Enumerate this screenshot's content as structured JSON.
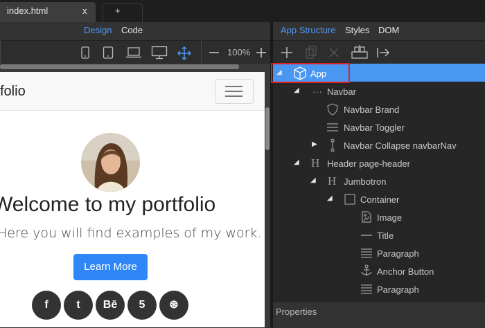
{
  "tabs": {
    "active": "index.html",
    "close": "x",
    "new": "+"
  },
  "left_panel": {
    "modes": {
      "design": "Design",
      "code": "Code"
    },
    "zoom": "100%"
  },
  "preview": {
    "brand": "folio",
    "heading": "Welcome to my portfolio",
    "subtitle": "Here you will find examples of my work.",
    "cta": "Learn More",
    "social": [
      "f",
      "t",
      "Bē",
      "5",
      "⊛"
    ]
  },
  "right_panel": {
    "tabs": {
      "app_structure": "App Structure",
      "styles": "Styles",
      "dom": "DOM"
    },
    "tree": [
      {
        "label": "App",
        "depth": 0,
        "expanded": true,
        "icon": "cube-icon",
        "selected": true
      },
      {
        "label": "Navbar",
        "depth": 1,
        "expanded": true,
        "icon": "dots-icon"
      },
      {
        "label": "Navbar Brand",
        "depth": 2,
        "icon": "shield-icon"
      },
      {
        "label": "Navbar Toggler",
        "depth": 2,
        "icon": "menu-icon"
      },
      {
        "label": "Navbar Collapse navbarNav",
        "depth": 2,
        "expanded": false,
        "icon": "collapse-icon"
      },
      {
        "label": "Header page-header",
        "depth": 1,
        "expanded": true,
        "icon": "heading-icon"
      },
      {
        "label": "Jumbotron",
        "depth": 2,
        "expanded": true,
        "icon": "heading-icon"
      },
      {
        "label": "Container",
        "depth": 3,
        "expanded": true,
        "icon": "square-icon"
      },
      {
        "label": "Image",
        "depth": 4,
        "icon": "image-icon"
      },
      {
        "label": "Title",
        "depth": 4,
        "icon": "line-icon"
      },
      {
        "label": "Paragraph",
        "depth": 4,
        "icon": "paragraph-icon"
      },
      {
        "label": "Anchor Button",
        "depth": 4,
        "icon": "anchor-icon"
      },
      {
        "label": "Paragraph",
        "depth": 4,
        "icon": "paragraph-icon"
      }
    ],
    "properties_label": "Properties"
  }
}
